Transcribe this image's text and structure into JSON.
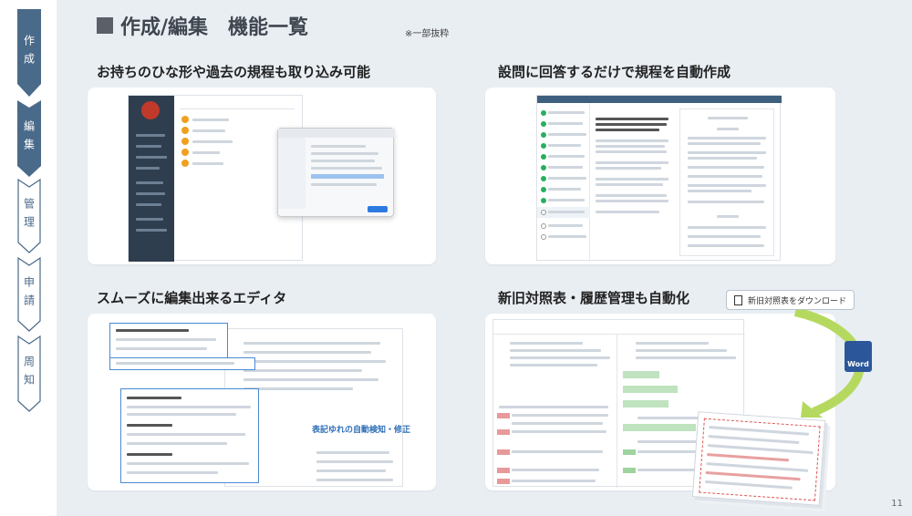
{
  "steps": [
    {
      "label": "作成",
      "active": false
    },
    {
      "label": "編集",
      "active": true
    },
    {
      "label": "管理",
      "active": false
    },
    {
      "label": "申請",
      "active": false
    },
    {
      "label": "周知",
      "active": false
    }
  ],
  "header": {
    "title": "作成/編集　機能一覧",
    "note": "※一部抜粋"
  },
  "sections": {
    "import": {
      "title": "お持ちのひな形や過去の規程も取り込み可能"
    },
    "auto": {
      "title": "設問に回答するだけで規程を自動作成"
    },
    "editor": {
      "title": "スムーズに編集出来るエディタ",
      "caption": "表記ゆれの自動検知・修正"
    },
    "compare": {
      "title": "新旧対照表・履歴管理も自動化",
      "download_label": "新旧対照表をダウンロード",
      "word_label": "Word"
    }
  },
  "page_number": "11",
  "colors": {
    "nav_active": "#4a6a8a",
    "nav_inactive_border": "#4a6a8a",
    "panel_bg": "#e9eef3",
    "title": "#404650"
  }
}
